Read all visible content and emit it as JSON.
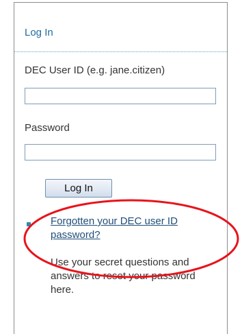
{
  "panel": {
    "title": "Log In",
    "userid_label": "DEC User ID (e.g. jane.citizen)",
    "userid_value": "",
    "password_label": "Password",
    "password_value": "",
    "login_button_label": "Log In",
    "forgot_link": "Forgotten your DEC user ID password?",
    "help_text": "Use your secret questions and answers to reset your password here."
  },
  "colors": {
    "title": "#1f6b9e",
    "link": "#1f4e79",
    "bullet": "#2f88b6",
    "annotation": "#e8131b"
  }
}
